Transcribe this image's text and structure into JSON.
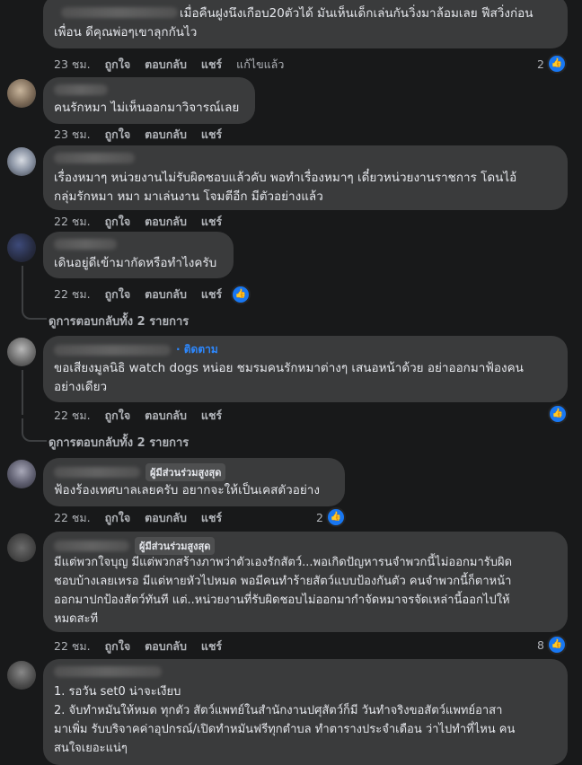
{
  "actions": {
    "like": "ถูกใจ",
    "reply": "ตอบกลับ",
    "share": "แชร์",
    "edited": "แก้ไขแล้ว"
  },
  "comments": [
    {
      "line1": "เมื่อคืนฝูงนึงเกือบ20ตัวได้ มันเห็นเด็กเล่นกันวิ่งมาล้อมเลย ฟีสวิ่งก่อน",
      "line2": "เพื่อน ดีคุณพ่อๆเขาลุกกันไว",
      "time": "23 ชม.",
      "likes": "2"
    },
    {
      "line1": "คนรักหมา ไม่เห็นออกมาวิจารณ์เลย",
      "time": "23 ชม."
    },
    {
      "line1": "เรื่องหมาๆ หน่วยงานไม่รับผิดชอบแล้วคับ พอทำเรื่องหมาๆ เดี๋ยวหน่วยงานราชการ โดนไอ้",
      "line2": "กลุ่มรักหมา หมา มาเล่นงาน โจมตีอีก มีตัวอย่างแล้ว",
      "time": "22 ชม."
    },
    {
      "line1": "เดินอยู่ดีเข้ามากัดหรือทำไงครับ",
      "time": "22 ชม.",
      "replies": "ดูการตอบกลับทั้ง 2 รายการ"
    },
    {
      "follow": "· ติดตาม",
      "line1": "ขอเสียงมูลนิธิ watch dogs หน่อย ชมรมคนรักหมาต่างๆ เสนอหน้าด้วย อย่าออกมาฟ้องคน",
      "line2": "อย่างเดียว",
      "time": "22 ชม.",
      "replies": "ดูการตอบกลับทั้ง 2 รายการ"
    },
    {
      "badge": "ผู้มีส่วนร่วมสูงสุด",
      "line1": "ฟ้องร้องเทศบาลเลยครับ อยากจะให้เป็นเคสตัวอย่าง",
      "time": "22 ชม.",
      "likes": "2"
    },
    {
      "badge": "ผู้มีส่วนร่วมสูงสุด",
      "line1": "มีแต่พวกใจบุญ มีแต่พวกสร้างภาพว่าตัวเองรักสัตว์...พอเกิดปัญหารนจำพวกนี้ไม่ออกมารับผิด",
      "line2": "ชอบบ้างเลยเหรอ มีแต่หายหัวไปหมด พอมีคนทำร้ายสัตว์แบบป้องกันตัว คนจำพวกนี้ก็ตาหน้า",
      "line3": "ออกมาปกป้องสัตว์ทันที แต่..หน่วยงานที่รับผิดชอบไม่ออกมากำจัดหมาจรจัดเหล่านี้ออกไปให้",
      "line4": "หมดสะที",
      "time": "22 ชม.",
      "likes": "8"
    },
    {
      "line1": "1. รอวัน set0 น่าจะเงียบ",
      "line2": "2. จับทำหมันให้หมด ทุกตัว สัตว์แพทย์ในสำนักงานปศุสัตว์ก็มี วันทำจริงขอสัตว์แพทย์อาสา",
      "line3": "มาเพิ่ม รับบริจาคค่าอุปกรณ์/เปิดทำหมันฟรีทุกตำบล ทำตารางประจำเดือน ว่าไปทำที่ไหน คน",
      "line4": "สนใจเยอะแน่ๆ"
    }
  ]
}
